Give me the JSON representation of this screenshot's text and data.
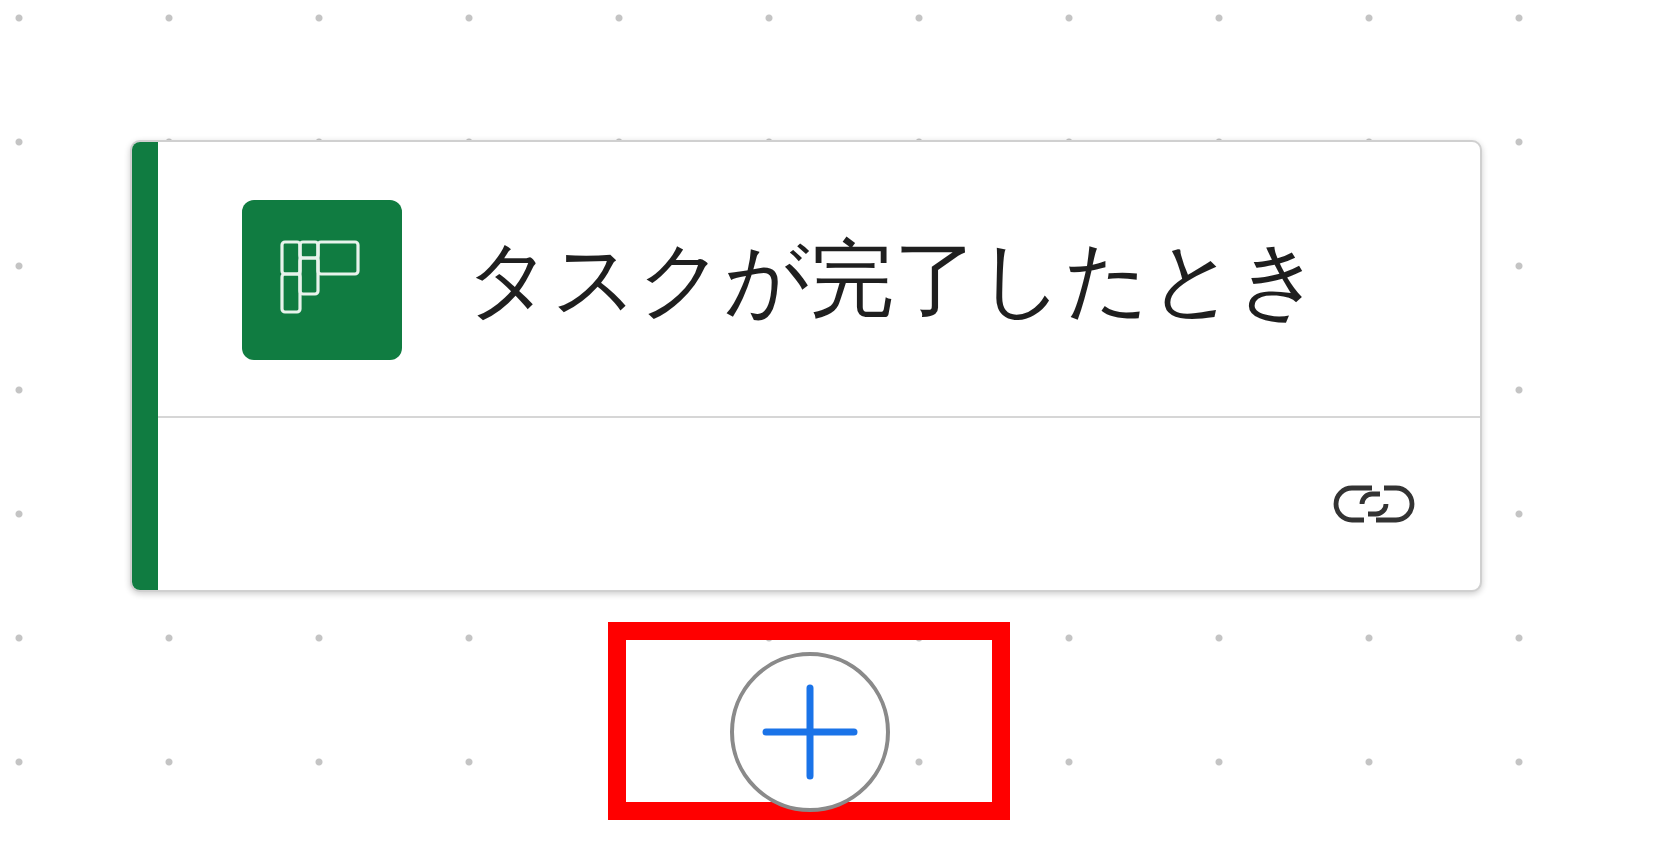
{
  "trigger": {
    "title": "タスクが完了したとき"
  },
  "add_step": {
    "highlighted": true
  }
}
